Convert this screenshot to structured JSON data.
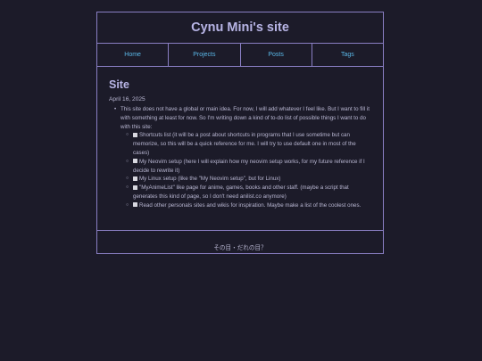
{
  "header": {
    "title": "Cynu Mini's site"
  },
  "nav": [
    {
      "label": "Home"
    },
    {
      "label": "Projects"
    },
    {
      "label": "Posts"
    },
    {
      "label": "Tags"
    }
  ],
  "main": {
    "title": "Site",
    "date": "April 16, 2025",
    "intro": "This site does not have a global or main idea. For now, I will add whatever I feel like. But I want to fill it with something at least for now. So I'm writing down a kind of to-do list of possible things I want to do with this site:",
    "todos": [
      {
        "text": "Shortcuts list (it will be a post about shortcuts in programs that I use sometime but can memorize, so this will be a quick reference for me. I will try to use default one in most of the cases)",
        "checked": false
      },
      {
        "text": "My Neovim setup (here I will explain how my neovim setup works, for my future reference if I decide to rewrite it)",
        "checked": false
      },
      {
        "text": "My Linux setup (like the \"My Neovim setup\", but for Linux)",
        "checked": false
      },
      {
        "text": "\"MyAnimeList\" like page for anime, games, books and other staff. (maybe a script that generates this kind of page, so I don't need anilist.co anymore)",
        "checked": false
      },
      {
        "text": "Read other personals sites and wikis for inspiration. Maybe make a list of the coolest ones.",
        "checked": false
      }
    ]
  },
  "footer": {
    "text": "その目・だれの目？"
  },
  "colors": {
    "background": "#1c1b29",
    "border": "#8a7fc4",
    "link": "#5ab8e8",
    "heading": "#b8b5e6"
  }
}
